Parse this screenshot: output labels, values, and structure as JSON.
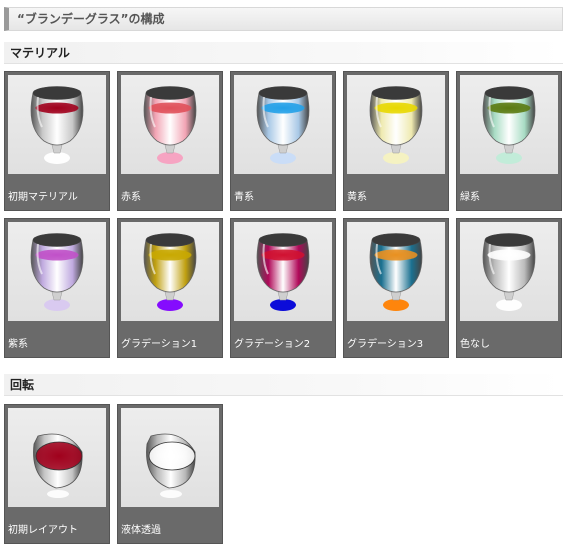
{
  "page": {
    "title": "“ブランデーグラス”の構成"
  },
  "sections": {
    "material": {
      "title": "マテリアル"
    },
    "rotation": {
      "title": "回転"
    }
  },
  "material_items": [
    {
      "label": "初期マテリアル",
      "liquid": "#a0001c",
      "glass": "#c8c8c8",
      "base": "#ffffff"
    },
    {
      "label": "赤系",
      "liquid": "#e0505a",
      "glass": "#f2a4b4",
      "base": "#f7a0c0"
    },
    {
      "label": "青系",
      "liquid": "#22a0e8",
      "glass": "#a8c8e6",
      "base": "#c8dcf8"
    },
    {
      "label": "黄系",
      "liquid": "#e8d800",
      "glass": "#efeab0",
      "base": "#f6f2c0"
    },
    {
      "label": "緑系",
      "liquid": "#5a7a10",
      "glass": "#a8dcc4",
      "base": "#c0ecd8"
    },
    {
      "label": "紫系",
      "liquid": "#c050c8",
      "glass": "#c0aae0",
      "base": "#d8c8f0"
    },
    {
      "label": "グラデーション1",
      "liquid": "#c8a800",
      "glass": "#c0a010",
      "base": "#8000ff"
    },
    {
      "label": "グラデーション2",
      "liquid": "#d01030",
      "glass": "#b00858",
      "base": "#0000d8"
    },
    {
      "label": "グラデーション3",
      "liquid": "#e89020",
      "glass": "#1a7090",
      "base": "#ff8000"
    },
    {
      "label": "色なし",
      "liquid": "#ffffff",
      "glass": "#bbbbbb",
      "base": "#ffffff"
    }
  ],
  "rotation_items": [
    {
      "label": "初期レイアウト",
      "liquid": "#a0001c",
      "glass": "#c4c4c4",
      "base": "#ffffff"
    },
    {
      "label": "液体透過",
      "liquid": "#ffffff",
      "glass": "#b8b8b8",
      "base": "#ffffff"
    }
  ]
}
